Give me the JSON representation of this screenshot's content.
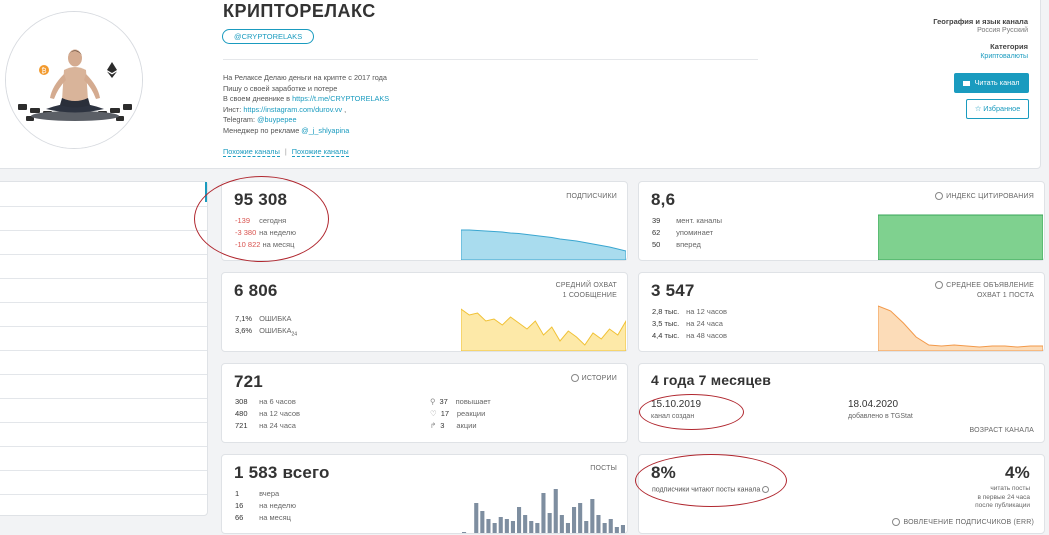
{
  "header": {
    "title": "КРИПТОРЕЛАКС",
    "handle": "@CRYPTORELAKS",
    "desc_lines": [
      "На Релаксе Делаю деньги на крипте с 2017 года",
      "Пишу о своей заработке и потере"
    ],
    "diary_prefix": "В своем дневнике в ",
    "diary_link": "https://t.me/CRYPTORELAKS",
    "inst_prefix": "Инст: ",
    "inst_link": "https://instagram.com/durov.vv",
    "inst_suffix": " ,",
    "telegram_prefix": "Telegram: ",
    "telegram_link": "@buypepee",
    "manager_prefix": "Менеджер по рекламе ",
    "manager_link": "@_j_shlyapina",
    "similar1": "Похожие каналы",
    "sep": "|",
    "similar2": "Похожие каналы",
    "geo_title": "География и язык канала",
    "geo_value": "Россия Русский",
    "cat_title": "Категория",
    "cat_value": "Криптовалюты",
    "read_btn": "Читать канал",
    "fav_btn": "Избранное"
  },
  "subscribers": {
    "value": "95 308",
    "label": "ПОДПИСЧИКИ",
    "rows": [
      {
        "v": "-139",
        "t": "сегодня"
      },
      {
        "v": "-3 380",
        "t": "на неделю"
      },
      {
        "v": "-10 822",
        "t": "на месяц"
      }
    ]
  },
  "citation": {
    "value": "8,6",
    "label": "ИНДЕКС ЦИТИРОВАНИЯ",
    "rows": [
      {
        "v": "39",
        "t": "мент. каналы"
      },
      {
        "v": "62",
        "t": "упоминает"
      },
      {
        "v": "50",
        "t": "вперед"
      }
    ]
  },
  "reach": {
    "value": "6 806",
    "label1": "СРЕДНИЙ ОХВАТ",
    "label2": "1 СООБЩЕНИЕ",
    "rows": [
      {
        "v": "7,1%",
        "t": "ОШИБКА",
        "s": ""
      },
      {
        "v": "3,6%",
        "t": "ОШИБКА",
        "s": "24"
      }
    ]
  },
  "adreach": {
    "value": "3 547",
    "label1": "СРЕДНЕЕ ОБЪЯВЛЕНИЕ",
    "label2": "ОХВАТ 1 ПОСТА",
    "rows": [
      {
        "v": "2,8 тыс.",
        "t": "на 12 часов"
      },
      {
        "v": "3,5 тыс.",
        "t": "на 24 часа"
      },
      {
        "v": "4,4 тыс.",
        "t": "на 48 часов"
      }
    ]
  },
  "stories": {
    "value": "721",
    "label": "ИСТОРИИ",
    "rows": [
      {
        "v": "308",
        "t": "на 6 часов"
      },
      {
        "v": "480",
        "t": "на 12 часов"
      },
      {
        "v": "721",
        "t": "на 24 часа"
      }
    ],
    "right": [
      {
        "v": "37",
        "t": "повышает"
      },
      {
        "v": "17",
        "t": "реакции"
      },
      {
        "v": "3",
        "t": "акции"
      }
    ]
  },
  "age": {
    "value": "4 года 7 месяцев",
    "created_date": "15.10.2019",
    "created_label": "канал создан",
    "added_date": "18.04.2020",
    "added_label": "добавлено в TGStat",
    "label": "ВОЗРАСТ КАНАЛА"
  },
  "posts": {
    "value": "1 583 всего",
    "label": "ПОСТЫ",
    "rows": [
      {
        "v": "1",
        "t": "вчера"
      },
      {
        "v": "16",
        "t": "на неделю"
      },
      {
        "v": "66",
        "t": "на месяц"
      }
    ]
  },
  "err": {
    "value": "8%",
    "sub": "подписчики читают посты канала",
    "right_value": "4%",
    "right_sub1": "читать посты",
    "right_sub2": "в первые 24 часа",
    "right_sub3": "после публикации",
    "label": "ВОВЛЕЧЕНИЕ ПОДПИСЧИКОВ (ERR)"
  },
  "colors": {
    "accent": "#1a9bbf",
    "blue_fill": "#a9dcee",
    "green_fill": "#7fd18f",
    "yellow_fill": "#fde9a8",
    "orange_fill": "#fcdcb8",
    "posts_bar": "#7e8ea0",
    "annotation": "#b0272f"
  },
  "chart_data": [
    {
      "type": "area",
      "title": "",
      "values": [
        30,
        30,
        29.5,
        29,
        28.5,
        28,
        27,
        26.5,
        25.5,
        24.5,
        23.5,
        22.5,
        21,
        20,
        19,
        17.5,
        16,
        14.5,
        13,
        11,
        9
      ]
    },
    {
      "type": "area",
      "title": "",
      "values": [
        45,
        45,
        45,
        45,
        45,
        45,
        45,
        45,
        45
      ]
    },
    {
      "type": "area",
      "title": "",
      "values": [
        42,
        36,
        38,
        30,
        32,
        26,
        34,
        28,
        22,
        30,
        16,
        24,
        10,
        20,
        14,
        6,
        18,
        12,
        22,
        16,
        30
      ]
    },
    {
      "type": "area",
      "title": "",
      "values": [
        45,
        40,
        28,
        14,
        6,
        5,
        6,
        5,
        4,
        5,
        5,
        4,
        5,
        5
      ]
    },
    {
      "type": "bar",
      "title": "",
      "values": [
        1,
        0,
        30,
        22,
        14,
        10,
        16,
        14,
        12,
        26,
        18,
        12,
        10,
        40,
        20,
        44,
        18,
        10,
        26,
        30,
        12,
        34,
        18,
        10,
        14,
        6,
        8
      ]
    }
  ]
}
